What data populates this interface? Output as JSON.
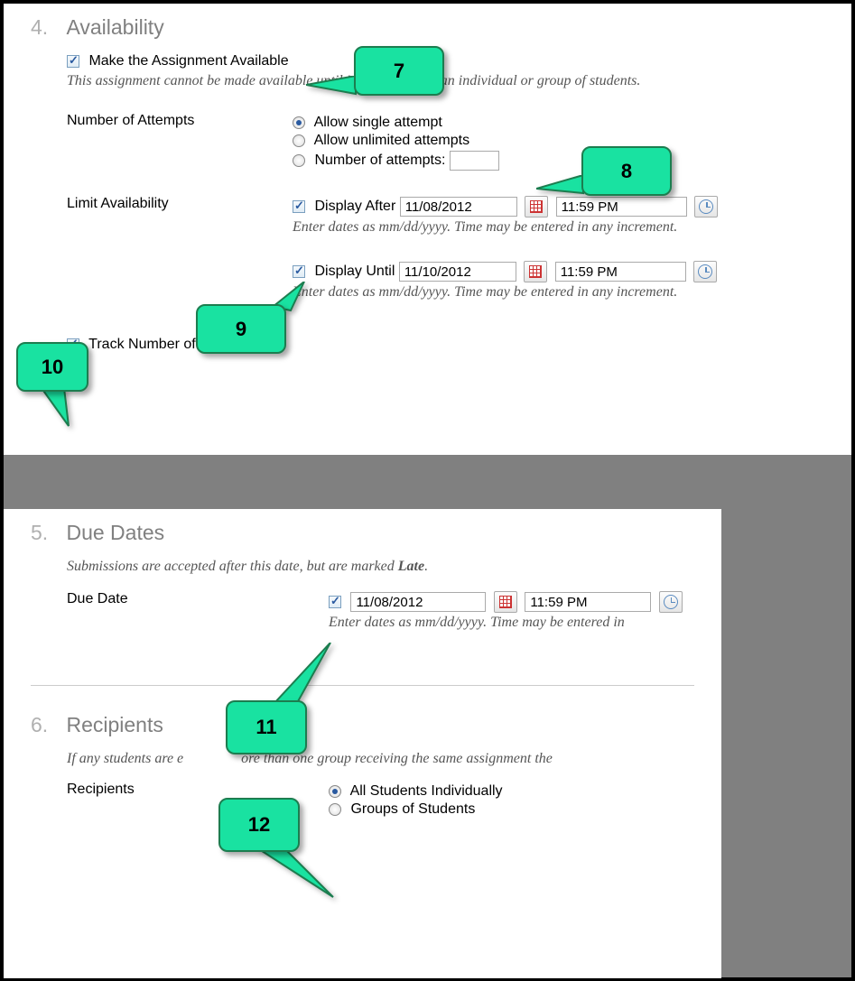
{
  "callouts": {
    "c7": "7",
    "c8": "8",
    "c9": "9",
    "c10": "10",
    "c11": "11",
    "c12": "12"
  },
  "section4": {
    "num": "4.",
    "title": "Availability",
    "make_available_label": "Make the Assignment Available",
    "note": "This assignment cannot be made available until it is assigned to an individual or group of students.",
    "attempts_label": "Number of Attempts",
    "opt_single": "Allow single attempt",
    "opt_unlimited": "Allow unlimited attempts",
    "opt_number": "Number of attempts:",
    "limit_label": "Limit Availability",
    "display_after_label": "Display After",
    "display_after_date": "11/08/2012",
    "display_after_time": "11:59 PM",
    "display_until_label": "Display Until",
    "display_until_date": "11/10/2012",
    "display_until_time": "11:59 PM",
    "date_hint": "Enter dates as mm/dd/yyyy. Time may be entered in any increment.",
    "track_views_label": "Track Number of Views"
  },
  "section5": {
    "num": "5.",
    "title": "Due Dates",
    "note_prefix": "Submissions are accepted after this date, but are marked ",
    "note_bold": "Late",
    "note_suffix": ".",
    "due_label": "Due Date",
    "due_date": "11/08/2012",
    "due_time": "11:59 PM",
    "date_hint": "Enter dates as mm/dd/yyyy. Time may be entered in"
  },
  "section6": {
    "num": "6.",
    "title": "Recipients",
    "note_prefix": "If any students are e",
    "note_suffix": "ore than one group receiving the same assignment the",
    "recipients_label": "Recipients",
    "opt_all": "All Students Individually",
    "opt_groups": "Groups of Students"
  }
}
